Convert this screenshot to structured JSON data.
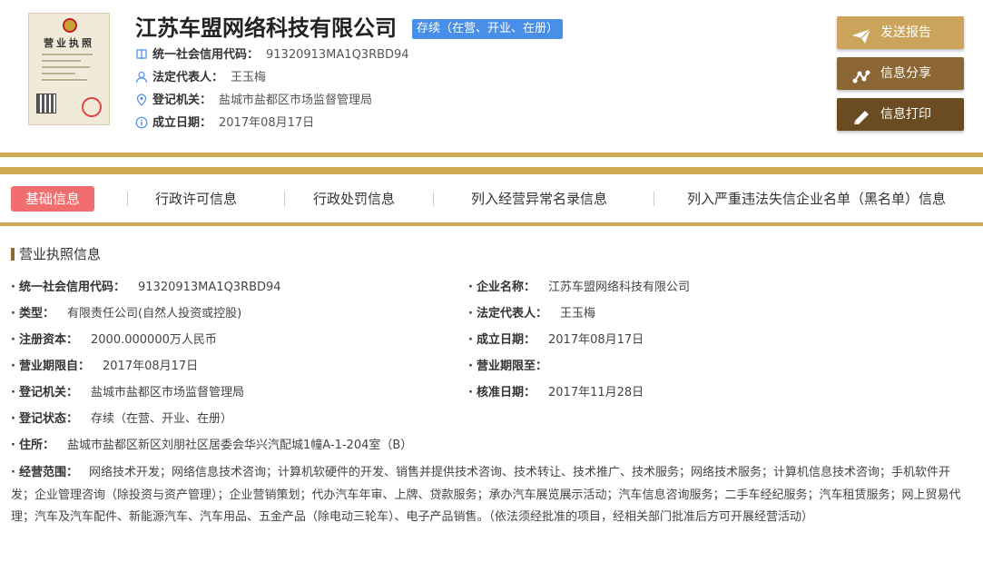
{
  "header": {
    "license_title": "营业执照",
    "company_name": "江苏车盟网络科技有限公司",
    "status_badge": "存续（在营、开业、在册）",
    "rows": [
      {
        "icon": "book-icon",
        "label": "统一社会信用代码：",
        "value": "91320913MA1Q3RBD94"
      },
      {
        "icon": "user-icon",
        "label": "法定代表人：",
        "value": "王玉梅"
      },
      {
        "icon": "location-pin-icon",
        "label": "登记机关：",
        "value": "盐城市盐都区市场监督管理局"
      },
      {
        "icon": "info-icon",
        "label": "成立日期：",
        "value": "2017年08月17日"
      }
    ],
    "buttons": {
      "send_report": "发送报告",
      "share_info": "信息分享",
      "print_info": "信息打印"
    }
  },
  "tabs": [
    {
      "label": "基础信息",
      "active": true
    },
    {
      "label": "行政许可信息",
      "active": false
    },
    {
      "label": "行政处罚信息",
      "active": false
    },
    {
      "label": "列入经营异常名录信息",
      "active": false
    },
    {
      "label": "列入严重违法失信企业名单（黑名单）信息",
      "active": false
    }
  ],
  "section": {
    "title": "营业执照信息",
    "left_fields": [
      {
        "label": "统一社会信用代码：",
        "value": "91320913MA1Q3RBD94"
      },
      {
        "label": "类型：",
        "value": "有限责任公司(自然人投资或控股)"
      },
      {
        "label": "注册资本：",
        "value": "2000.000000万人民币"
      },
      {
        "label": "营业期限自：",
        "value": "2017年08月17日"
      },
      {
        "label": "登记机关：",
        "value": "盐城市盐都区市场监督管理局"
      },
      {
        "label": "登记状态：",
        "value": "存续（在营、开业、在册）"
      },
      {
        "label": "住所：",
        "value": "盐城市盐都区新区刘朋社区居委会华兴汽配城1幢A-1-204室（B）"
      }
    ],
    "right_fields": [
      {
        "label": "企业名称：",
        "value": "江苏车盟网络科技有限公司"
      },
      {
        "label": "法定代表人：",
        "value": "王玉梅"
      },
      {
        "label": "成立日期：",
        "value": "2017年08月17日"
      },
      {
        "label": "营业期限至：",
        "value": ""
      },
      {
        "label": "核准日期：",
        "value": "2017年11月28日"
      }
    ],
    "scope_label": "经营范围：",
    "scope_value": "网络技术开发；网络信息技术咨询；计算机软硬件的开发、销售并提供技术咨询、技术转让、技术推广、技术服务；网络技术服务；计算机信息技术咨询；手机软件开发；企业管理咨询（除投资与资产管理）；企业营销策划；代办汽车年审、上牌、贷款服务；承办汽车展览展示活动；汽车信息咨询服务；二手车经纪服务；汽车租赁服务；网上贸易代理；汽车及汽车配件、新能源汽车、汽车用品、五金产品（除电动三轮车）、电子产品销售。（依法须经批准的项目，经相关部门批准后方可开展经营活动）"
  },
  "colors": {
    "gold": "#cfa94f",
    "badge": "#4a8fe7",
    "active_tab": "#f26d6d",
    "btn_send": "#c9a45a",
    "btn_share": "#8c6635",
    "btn_print": "#6b4b22"
  }
}
